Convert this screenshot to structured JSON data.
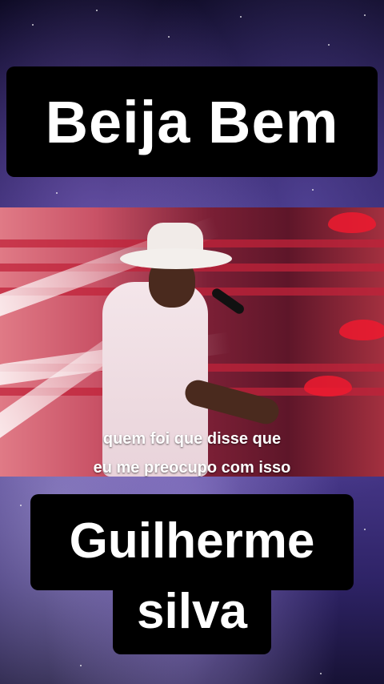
{
  "title": "Beija Bem",
  "video": {
    "lyrics_line_1": "quem foi que disse que",
    "lyrics_line_2": "eu me preocupo com isso"
  },
  "artist": {
    "line_1": "Guilherme",
    "line_2": "silva"
  },
  "colors": {
    "caption_bg": "#000000",
    "caption_text": "#ffffff",
    "stage_red": "#c0233a"
  }
}
